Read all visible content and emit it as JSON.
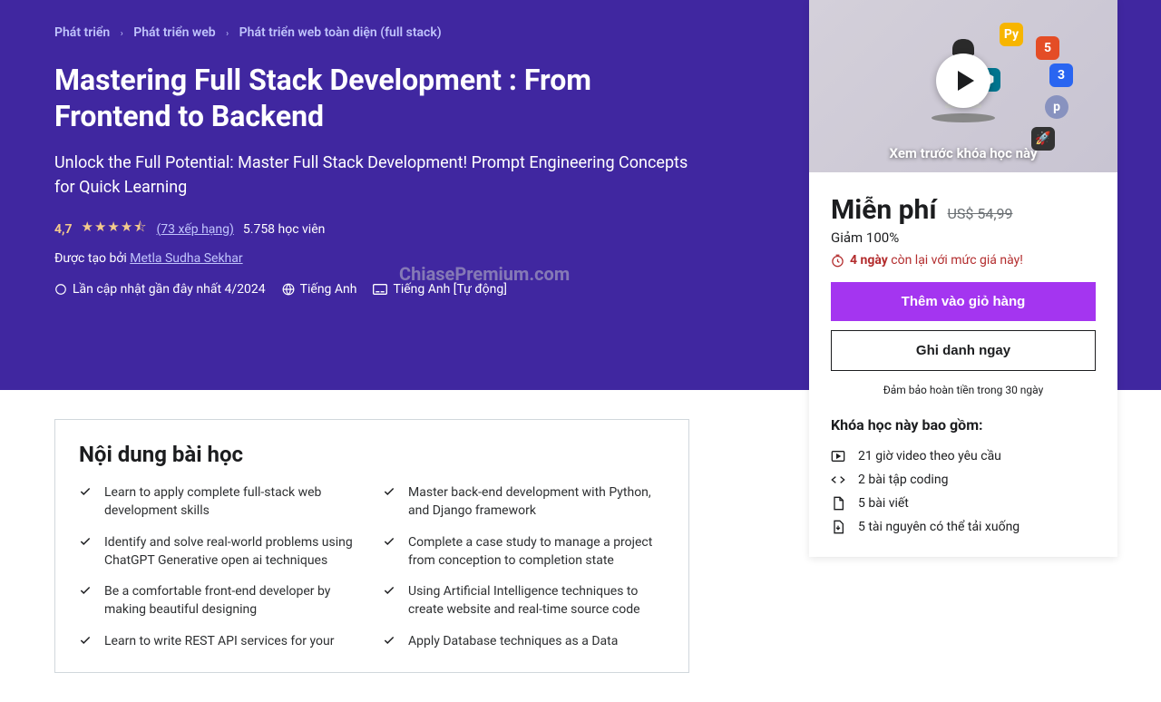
{
  "breadcrumb": {
    "l1": "Phát triển",
    "l2": "Phát triển web",
    "l3": "Phát triển web toàn diện (full stack)"
  },
  "course": {
    "title": "Mastering Full Stack Development : From Frontend to Backend",
    "subtitle": "Unlock the Full Potential: Master Full Stack Development! Prompt Engineering Concepts for Quick Learning",
    "rating": "4,7",
    "ratingsCount": "(73 xếp hạng)",
    "students": "5.758 học viên",
    "createdBy": "Được tạo bởi ",
    "author": "Metla Sudha Sekhar",
    "lastUpdate": "Lần cập nhật gần đây nhất 4/2024",
    "language": "Tiếng Anh",
    "captions": "Tiếng Anh [Tự động]"
  },
  "watermark": "ChiasePremium.com",
  "preview": {
    "text": "Xem trước khóa học này"
  },
  "price": {
    "current": "Miễn phí",
    "original": "US$ 54,99",
    "discount": "Giảm 100%",
    "timerBold": "4 ngày",
    "timerRest": " còn lại với mức giá này!"
  },
  "buttons": {
    "addToCart": "Thêm vào giỏ hàng",
    "enroll": "Ghi danh ngay"
  },
  "guarantee": "Đảm bảo hoàn tiền trong 30 ngày",
  "includes": {
    "title": "Khóa học này bao gồm:",
    "items": [
      "21 giờ video theo yêu cầu",
      "2 bài tập coding",
      "5 bài viết",
      "5 tài nguyên có thể tải xuống"
    ]
  },
  "learn": {
    "title": "Nội dung bài học",
    "items": [
      "Learn to apply complete full-stack web development skills",
      "Master back-end development with Python, and Django framework",
      "Identify and solve real-world problems using ChatGPT Generative open ai techniques",
      "Complete a case study to manage a project from conception to completion state",
      "Be a comfortable front-end developer by making beautiful designing",
      "Using Artificial Intelligence techniques to create website and real-time source code",
      "Learn to write REST API services for your",
      "Apply Database techniques as a Data"
    ]
  }
}
